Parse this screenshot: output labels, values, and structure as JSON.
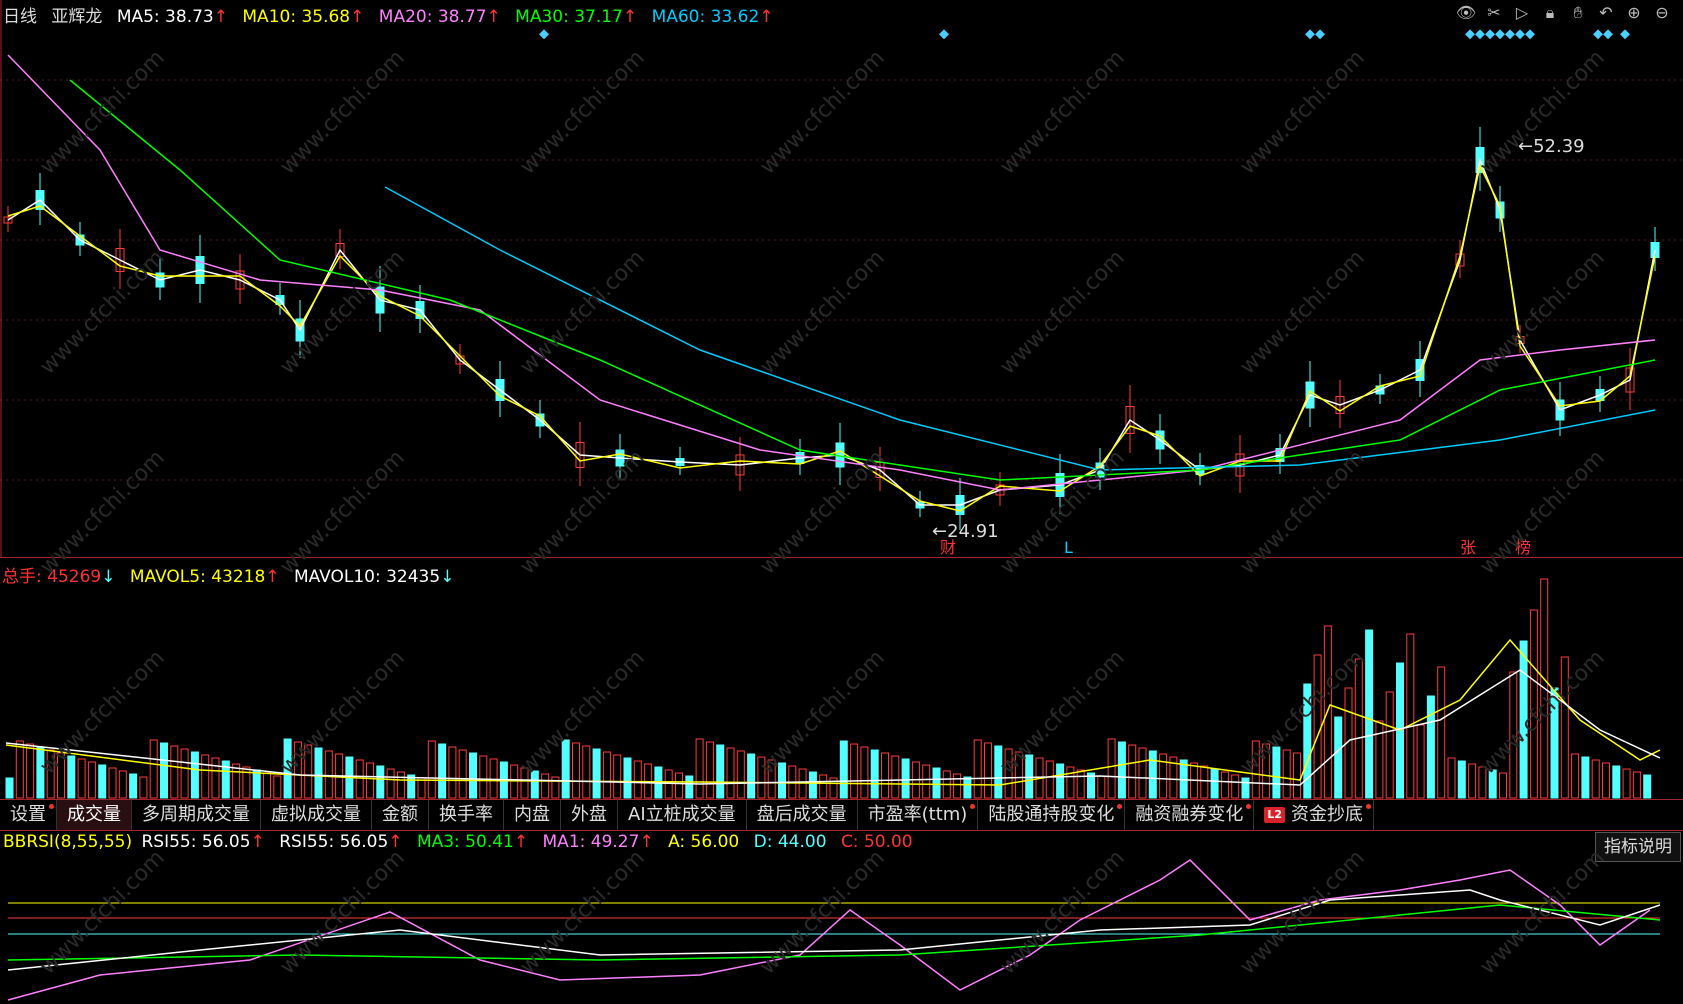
{
  "price_header": {
    "period": "日线",
    "name": "亚辉龙",
    "ma5": "MA5: 38.73",
    "ma10": "MA10: 35.68",
    "ma20": "MA20: 38.77",
    "ma30": "MA30: 37.17",
    "ma60": "MA60: 33.62",
    "up_arrow": "↑"
  },
  "annotations": {
    "high": "52.39",
    "low": "24.91",
    "tag_cai": "财",
    "tag_l": "L",
    "tag_zhang": "张",
    "tag_bang": "榜"
  },
  "volume_header": {
    "total": "总手: 45269",
    "total_arrow": "↓",
    "mavol5": "MAVOL5: 43218",
    "mavol5_arrow": "↑",
    "mavol10": "MAVOL10: 32435",
    "mavol10_arrow": "↓"
  },
  "tabs": [
    "设置",
    "成交量",
    "多周期成交量",
    "虚拟成交量",
    "金额",
    "换手率",
    "内盘",
    "外盘",
    "AI立桩成交量",
    "盘后成交量",
    "市盈率(ttm)",
    "陆股通持股变化",
    "融资融券变化",
    "资金抄底"
  ],
  "tab_l2_badge": "L2",
  "indicator_header": {
    "name": "BBRSI(8,55,55)",
    "rsi55a": "RSI55: 56.05",
    "rsi55b": "RSI55: 56.05",
    "ma3": "MA3: 50.41",
    "ma1": "MA1: 49.27",
    "a": "A: 56.00",
    "d": "D: 44.00",
    "c": "C: 50.00"
  },
  "explain_button": "指标说明",
  "watermark": "www.cfchi.com",
  "colors": {
    "up": "#ff3b3b",
    "down": "#54ffff",
    "ma5": "#ffffff",
    "ma10": "#ffff00",
    "ma20": "#ff80ff",
    "ma30": "#00ff00",
    "ma60": "#00ccff",
    "border": "#a4262c"
  },
  "icons": [
    "eye-icon",
    "scissors-icon",
    "play-icon",
    "lock-icon",
    "hand-icon",
    "undo-icon",
    "zoom-in-icon",
    "zoom-out-icon"
  ]
}
